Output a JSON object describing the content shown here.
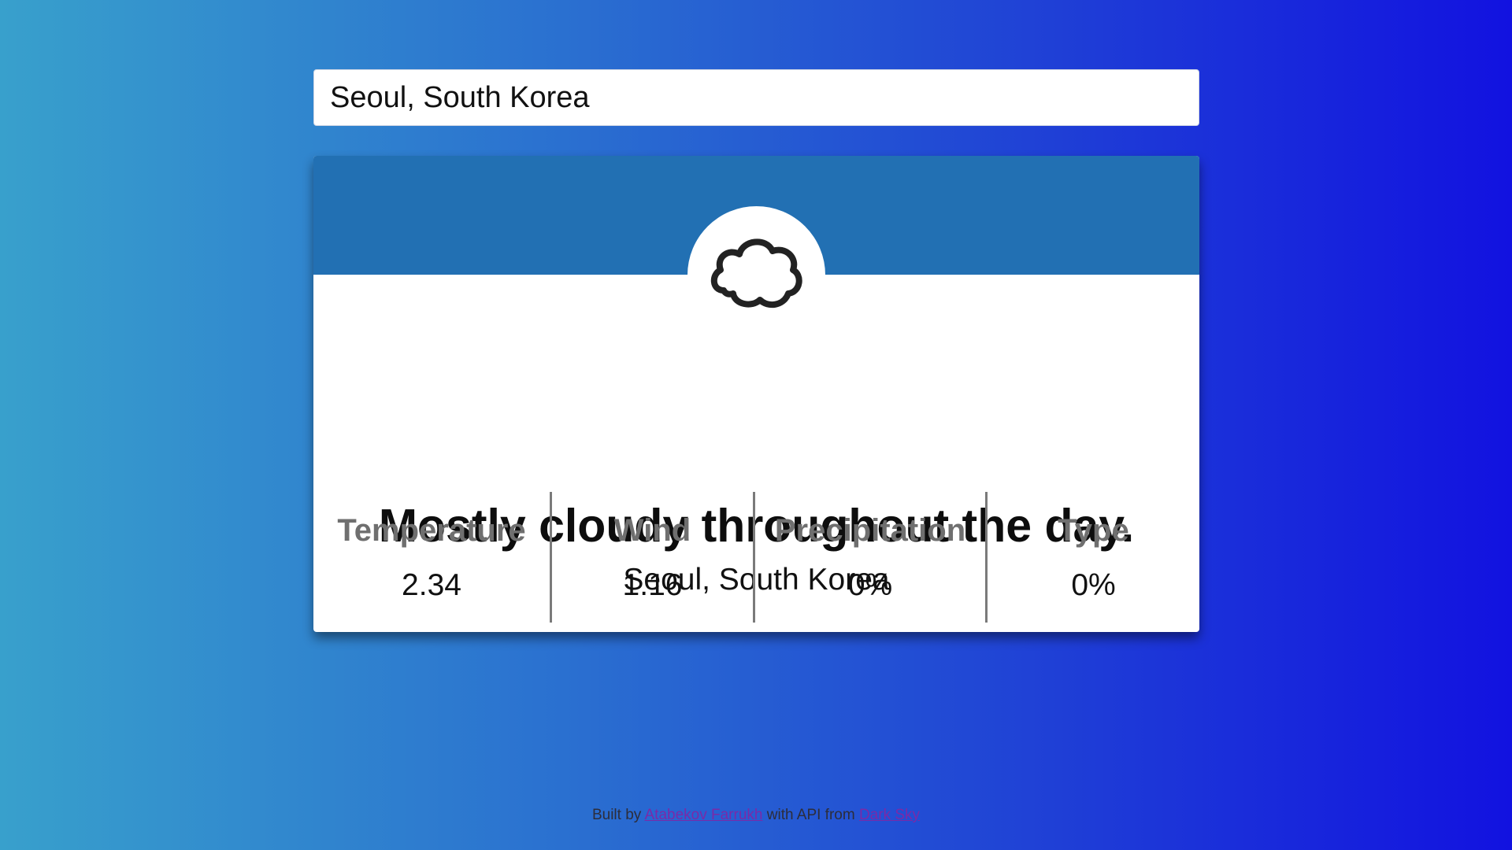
{
  "search": {
    "value": "Seoul, South Korea"
  },
  "card": {
    "icon": "cloud-icon",
    "summary": "Mostly cloudy throughout the day.",
    "location": "Seoul, South Korea",
    "stats": [
      {
        "label": "Temperature",
        "value": "2.34"
      },
      {
        "label": "Wind",
        "value": "1.16"
      },
      {
        "label": "Precipitation",
        "value": "0%"
      },
      {
        "label": "Type",
        "value": "0%"
      }
    ]
  },
  "footer": {
    "built_by": "Built by",
    "author_link": "Atabekov Farrukh",
    "middle": "with API from",
    "api_link": "Dark Sky"
  },
  "colors": {
    "header": "#2270b3",
    "background_start": "#38a0cc",
    "background_end": "#1212e0",
    "label_gray": "#6f6f6f",
    "link_visited": "#7a2aa8"
  }
}
